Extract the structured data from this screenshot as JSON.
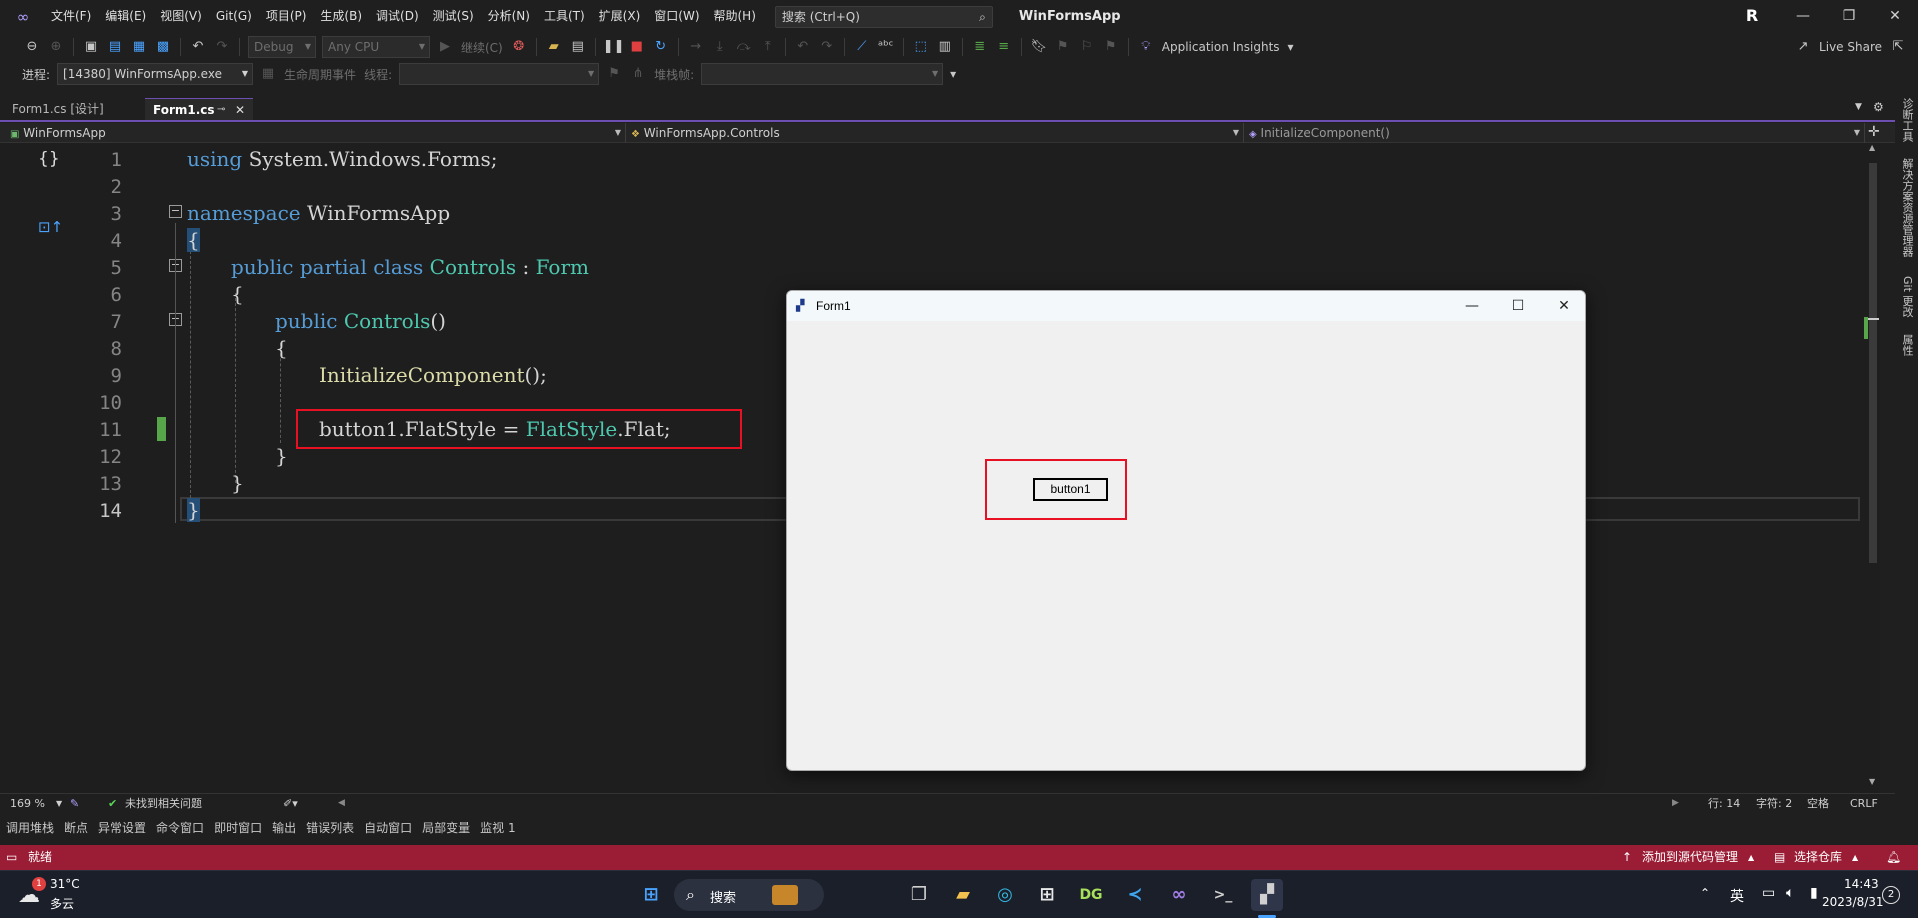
{
  "titlebar": {
    "menus": [
      "文件(F)",
      "编辑(E)",
      "视图(V)",
      "Git(G)",
      "项目(P)",
      "生成(B)",
      "调试(D)",
      "测试(S)",
      "分析(N)",
      "工具(T)",
      "扩展(X)",
      "窗口(W)",
      "帮助(H)"
    ],
    "search_placeholder": "搜索 (Ctrl+Q)",
    "app_title": "WinFormsApp",
    "avatar": "R"
  },
  "toolbar": {
    "config": "Debug",
    "platform": "Any CPU",
    "continue_label": "继续(C)",
    "app_insights": "Application Insights",
    "live_share": "Live Share",
    "process_label": "进程:",
    "process_value": "[14380] WinFormsApp.exe",
    "lifecycle_label": "生命周期事件",
    "thread_label": "线程:",
    "stackframe_label": "堆栈帧:"
  },
  "tabs": [
    {
      "label": "Form1.cs [设计]",
      "active": false
    },
    {
      "label": "Form1.cs",
      "active": true
    }
  ],
  "navbar": {
    "project": "WinFormsApp",
    "class": "WinFormsApp.Controls",
    "member": "InitializeComponent()"
  },
  "editor": {
    "line_numbers": [
      "1",
      "2",
      "3",
      "4",
      "5",
      "6",
      "7",
      "8",
      "9",
      "10",
      "11",
      "12",
      "13",
      "14"
    ],
    "current_line": 14,
    "zoom": "169 %",
    "issues": "未找到相关问题",
    "row": "行: 14",
    "col": "字符: 2",
    "whitespace": "空格",
    "eol": "CRLF"
  },
  "code": {
    "l1_kw": "using",
    "l1_rest": " System.Windows.Forms;",
    "l3_kw": "namespace",
    "l3_rest": " WinFormsApp",
    "l4": "{",
    "l5_kw": "public partial class",
    "l5_ty": "Controls",
    "l5_colon": " : ",
    "l5_base": "Form",
    "l6": "{",
    "l7_kw": "public",
    "l7_ty": "Controls",
    "l7_paren": "()",
    "l8": "{",
    "l9_fn": "InitializeComponent",
    "l9_rest": "();",
    "l11_a": "button1.FlatStyle = ",
    "l11_ty": "FlatStyle",
    "l11_b": ".Flat;",
    "l12": "}",
    "l13": "}",
    "l14": "}"
  },
  "form": {
    "title": "Form1",
    "button_label": "button1"
  },
  "side_labels": [
    "诊断工具",
    "解决方案资源管理器",
    "Git 更改",
    "属性"
  ],
  "tool_windows": [
    "调用堆栈",
    "断点",
    "异常设置",
    "命令窗口",
    "即时窗口",
    "输出",
    "错误列表",
    "自动窗口",
    "局部变量",
    "监视 1"
  ],
  "statusbar": {
    "ready": "就绪",
    "source_control": "添加到源代码管理",
    "repo": "选择仓库"
  },
  "taskbar": {
    "weather_temp": "31°C",
    "weather_desc": "多云",
    "weather_badge": "1",
    "search_label": "搜索",
    "ime": "英",
    "time": "14:43",
    "date": "2023/8/31",
    "notif_count": "2"
  },
  "colors": {
    "statusbar": "#9a1d35",
    "highlight_box": "#e81123",
    "accent": "#6c4fb0"
  }
}
